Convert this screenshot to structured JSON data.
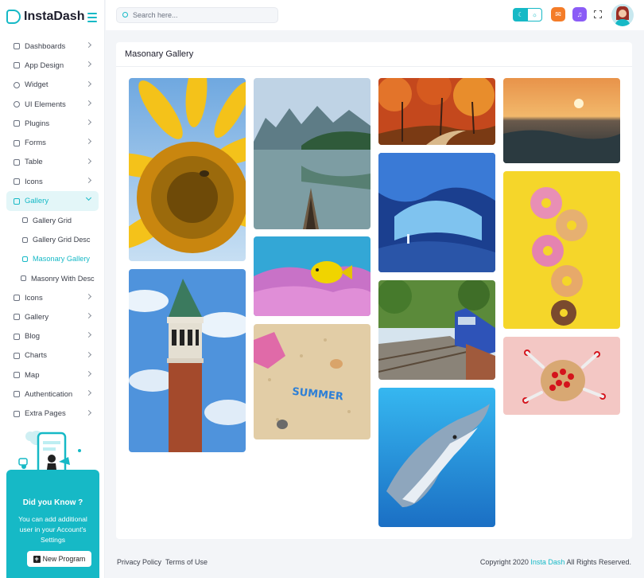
{
  "app": {
    "name": "InstaDash"
  },
  "search": {
    "placeholder": "Search here..."
  },
  "menu": [
    {
      "label": "Dashboards"
    },
    {
      "label": "App Design"
    },
    {
      "label": "Widget"
    },
    {
      "label": "UI Elements"
    },
    {
      "label": "Plugins"
    },
    {
      "label": "Forms"
    },
    {
      "label": "Table"
    },
    {
      "label": "Icons"
    },
    {
      "label": "Gallery"
    },
    {
      "label": "Gallery Grid"
    },
    {
      "label": "Gallery Grid Desc"
    },
    {
      "label": "Masonary Gallery"
    },
    {
      "label": "Masonry With Desc"
    },
    {
      "label": "Icons"
    },
    {
      "label": "Gallery"
    },
    {
      "label": "Blog"
    },
    {
      "label": "Charts"
    },
    {
      "label": "Map"
    },
    {
      "label": "Authentication"
    },
    {
      "label": "Extra Pages"
    }
  ],
  "promo": {
    "title": "Did you Know ?",
    "text": "You can add additional user in your Account's Settings",
    "button": "New Program"
  },
  "page": {
    "title": "Masonary Gallery"
  },
  "gallery": [
    {
      "name": "sunflower",
      "icon": "sunflower-photo"
    },
    {
      "name": "bell-tower",
      "icon": "tower-photo"
    },
    {
      "name": "mountain-lake",
      "icon": "lake-photo"
    },
    {
      "name": "coral-fish",
      "icon": "fish-photo"
    },
    {
      "name": "summer-beach",
      "icon": "beach-photo",
      "caption": "SUMMER"
    },
    {
      "name": "autumn-forest",
      "icon": "forest-photo"
    },
    {
      "name": "ice-cave",
      "icon": "cave-photo"
    },
    {
      "name": "train",
      "icon": "train-photo"
    },
    {
      "name": "dolphin",
      "icon": "dolphin-photo"
    },
    {
      "name": "ocean-sunset",
      "icon": "sunset-photo"
    },
    {
      "name": "donuts",
      "icon": "donut-photo"
    },
    {
      "name": "berries",
      "icon": "berry-photo"
    }
  ],
  "footer": {
    "privacy": "Privacy Policy",
    "terms": "Terms of Use",
    "copyright_prefix": "Copyright 2020",
    "brand": "Insta Dash",
    "copyright_suffix": "All Rights Reserved."
  },
  "colors": {
    "accent": "#16b9c6",
    "mail": "#f47c28",
    "bell": "#8b5cf6"
  }
}
